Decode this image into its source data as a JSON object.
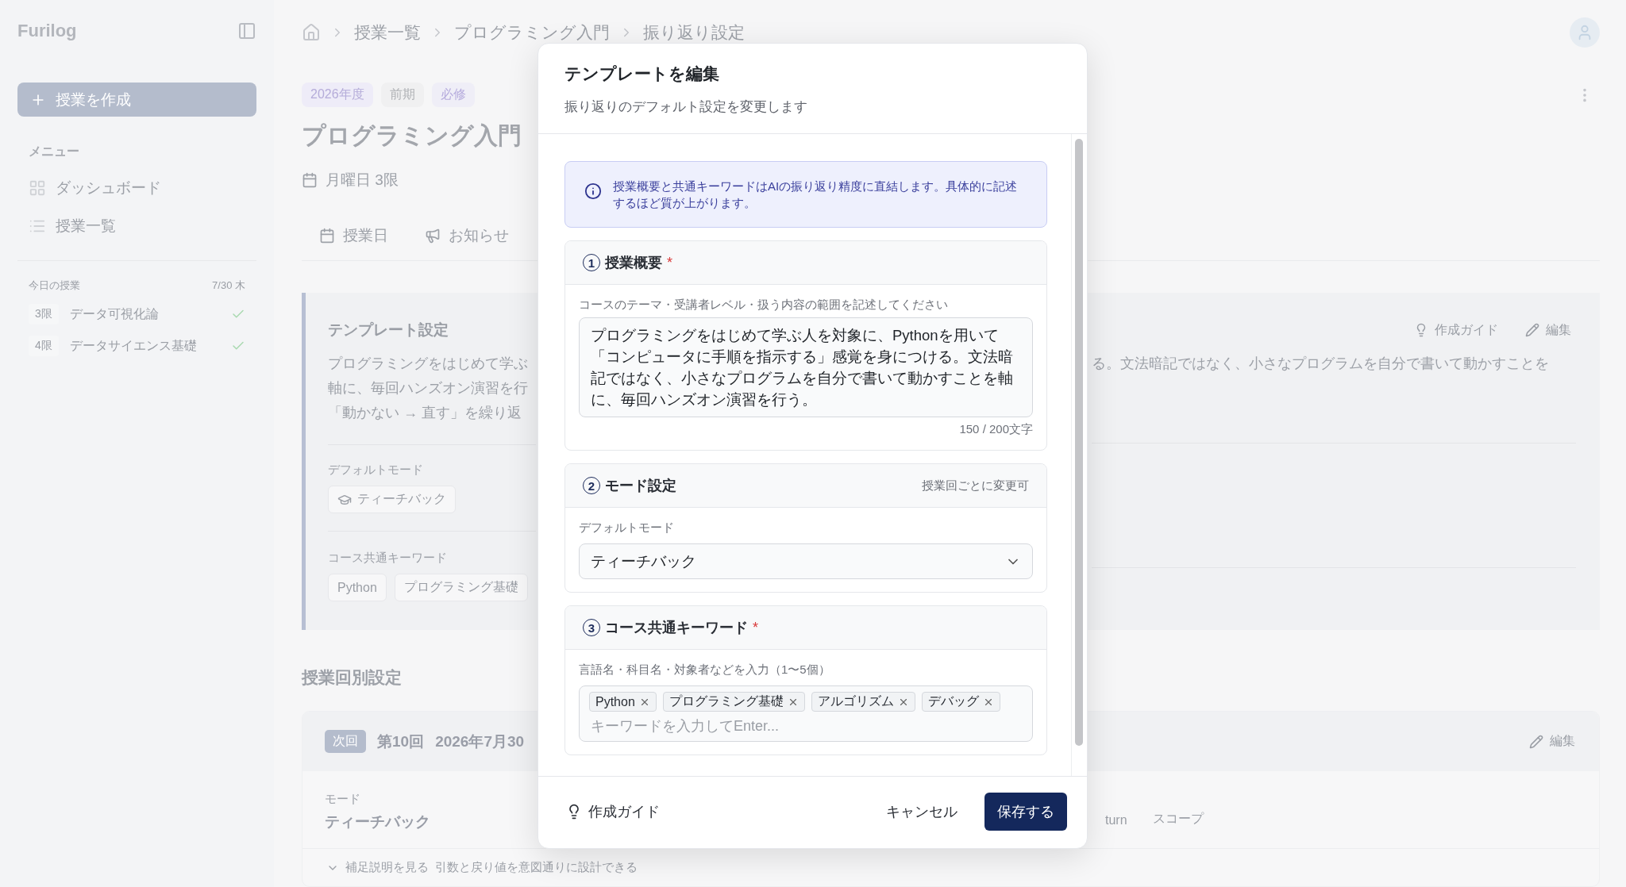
{
  "sidebar": {
    "brand": "Furilog",
    "create_button": "授業を作成",
    "menu_heading": "メニュー",
    "menu_items": [
      {
        "label": "ダッシュボード",
        "kind": "dashboard"
      },
      {
        "label": "授業一覧",
        "kind": "list"
      }
    ],
    "today_heading": "今日の授業",
    "today_date": "7/30 木",
    "today_classes": [
      {
        "period": "3限",
        "name": "データ可視化論",
        "done": true
      },
      {
        "period": "4限",
        "name": "データサイエンス基礎",
        "done": true
      }
    ]
  },
  "breadcrumb": [
    "授業一覧",
    "プログラミング入門",
    "振り返り設定"
  ],
  "course": {
    "tags": [
      {
        "label": "2026年度",
        "kind": "year"
      },
      {
        "label": "前期",
        "kind": "term"
      },
      {
        "label": "必修",
        "kind": "required"
      }
    ],
    "title": "プログラミング入門",
    "schedule": "月曜日 3限"
  },
  "tabs": [
    {
      "label": "授業日",
      "kind": "calendar",
      "selected": false
    },
    {
      "label": "お知らせ",
      "kind": "announce",
      "selected": false
    }
  ],
  "template_card": {
    "title": "テンプレート設定",
    "guide_button": "作成ガイド",
    "edit_button": "編集",
    "summary_left": [
      "プログラミングをはじめて学ぶ",
      "軸に、毎回ハンズオン演習を行",
      "「動かない → 直す」を繰り返"
    ],
    "summary_right": "る。文法暗記ではなく、小さなプログラムを自分で書いて動かすことを",
    "mode_label": "デフォルトモード",
    "mode": "ティーチバック",
    "keywords_label": "コース共通キーワード",
    "keywords": [
      "Python",
      "プログラミング基礎"
    ]
  },
  "sessions_heading": "授業回別設定",
  "session_card": {
    "badge": "次回",
    "number": "第10回",
    "date": "2026年7月30",
    "edit_button": "編集",
    "mode_label": "モード",
    "mode": "ティーチバック",
    "keywords": [
      "turn",
      "スコープ"
    ],
    "details_toggle": "補足説明を見る",
    "goal": "引数と戻り値を意図通りに設計できる"
  },
  "modal": {
    "title": "テンプレートを編集",
    "subtitle": "振り返りのデフォルト設定を変更します",
    "info": "授業概要と共通キーワードはAIの振り返り精度に直結します。具体的に記述するほど質が上がります。",
    "sections": [
      {
        "kind": "summary",
        "number": "1",
        "title": "授業概要",
        "required_mark": "*",
        "hint": "コースのテーマ・受講者レベル・扱う内容の範囲を記述してください",
        "value": "プログラミングをはじめて学ぶ人を対象に、Pythonを用いて「コンピュータに手順を指示する」感覚を身につける。文法暗記ではなく、小さなプログラムを自分で書いて動かすことを軸に、毎回ハンズオン演習を行う。",
        "counter": "150 / 200文字"
      },
      {
        "kind": "select",
        "number": "2",
        "title": "モード設定",
        "note": "授業回ごとに変更可",
        "hint": "デフォルトモード",
        "value": "ティーチバック"
      },
      {
        "kind": "tags",
        "number": "3",
        "title": "コース共通キーワード",
        "required_mark": "*",
        "hint": "言語名・科目名・対象者などを入力（1〜5個）",
        "tags": [
          "Python",
          "プログラミング基礎",
          "アルゴリズム",
          "デバッグ"
        ],
        "placeholder": "キーワードを入力してEnter..."
      }
    ],
    "guide_button": "作成ガイド",
    "cancel_button": "キャンセル",
    "save_button": "保存する"
  }
}
